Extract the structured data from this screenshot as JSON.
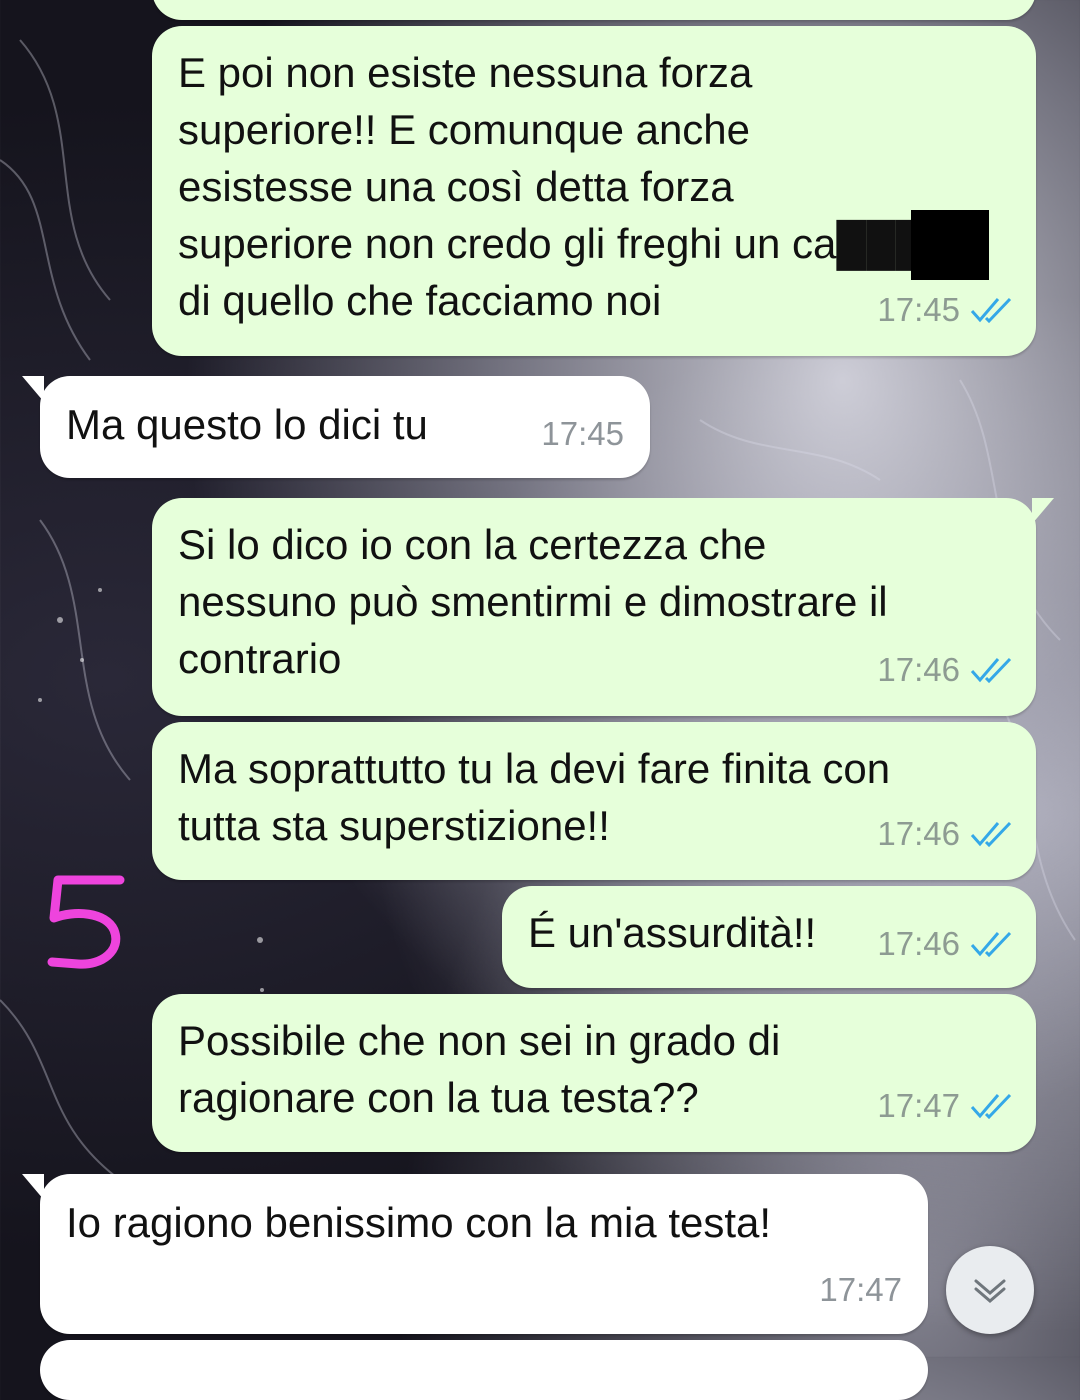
{
  "messages": [
    {
      "text": "",
      "time": "",
      "direction": "outgoing"
    },
    {
      "text": "E poi non esiste nessuna forza\nsuperiore!! E comunque anche\nesistesse una così detta forza\nsuperiore non credo gli freghi un ca███o\ndi quello che facciamo noi",
      "time": "17:45",
      "direction": "outgoing"
    },
    {
      "text": "Ma questo lo dici tu",
      "time": "17:45",
      "direction": "incoming"
    },
    {
      "text": "Si lo dico io con la certezza che\nnessuno può smentirmi e dimostrare il\ncontrario",
      "time": "17:46",
      "direction": "outgoing"
    },
    {
      "text": "Ma soprattutto tu la devi fare finita con\ntutta sta superstizione!!",
      "time": "17:46",
      "direction": "outgoing"
    },
    {
      "text": "É un'assurdità!!",
      "time": "17:46",
      "direction": "outgoing"
    },
    {
      "text": "Possibile che non sei in grado di\nragionare con la tua testa??",
      "time": "17:47",
      "direction": "outgoing"
    },
    {
      "text": "Io ragiono benissimo con la mia testa!",
      "time": "17:47",
      "direction": "incoming"
    }
  ],
  "annotation": {
    "text": "5",
    "color": "#ee44dd"
  },
  "icons": {
    "read_receipt": "double-check-icon",
    "scroll_down": "chevron-down-icon"
  },
  "colors": {
    "outgoing_bubble": "#e6ffda",
    "incoming_bubble": "#ffffff",
    "read_ticks": "#34a8e8"
  }
}
